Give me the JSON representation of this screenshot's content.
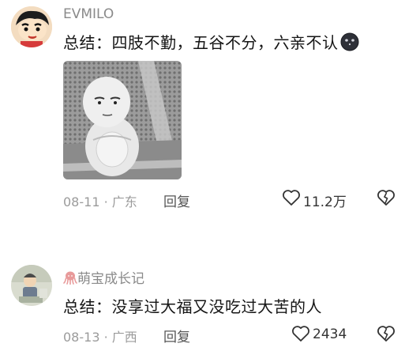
{
  "comments": [
    {
      "username": "EVMILO",
      "text": "总结：四肢不勤，五谷不分，六亲不认",
      "emoji_icon": "dark-face-emoji-icon",
      "date": "08-11",
      "location": "广东",
      "reply_label": "回复",
      "likes": "11.2万"
    },
    {
      "username": "萌宝成长记",
      "username_badge_icon": "octopus-icon",
      "text": "总结：没享过大福又没吃过大苦的人",
      "date": "08-13",
      "location": "广西",
      "reply_label": "回复",
      "likes": "2434"
    }
  ],
  "separator": " · ",
  "colors": {
    "meta": "#9b9b9b",
    "text": "#151515",
    "username": "#8a8a8a",
    "badge": "#e89a9a"
  }
}
